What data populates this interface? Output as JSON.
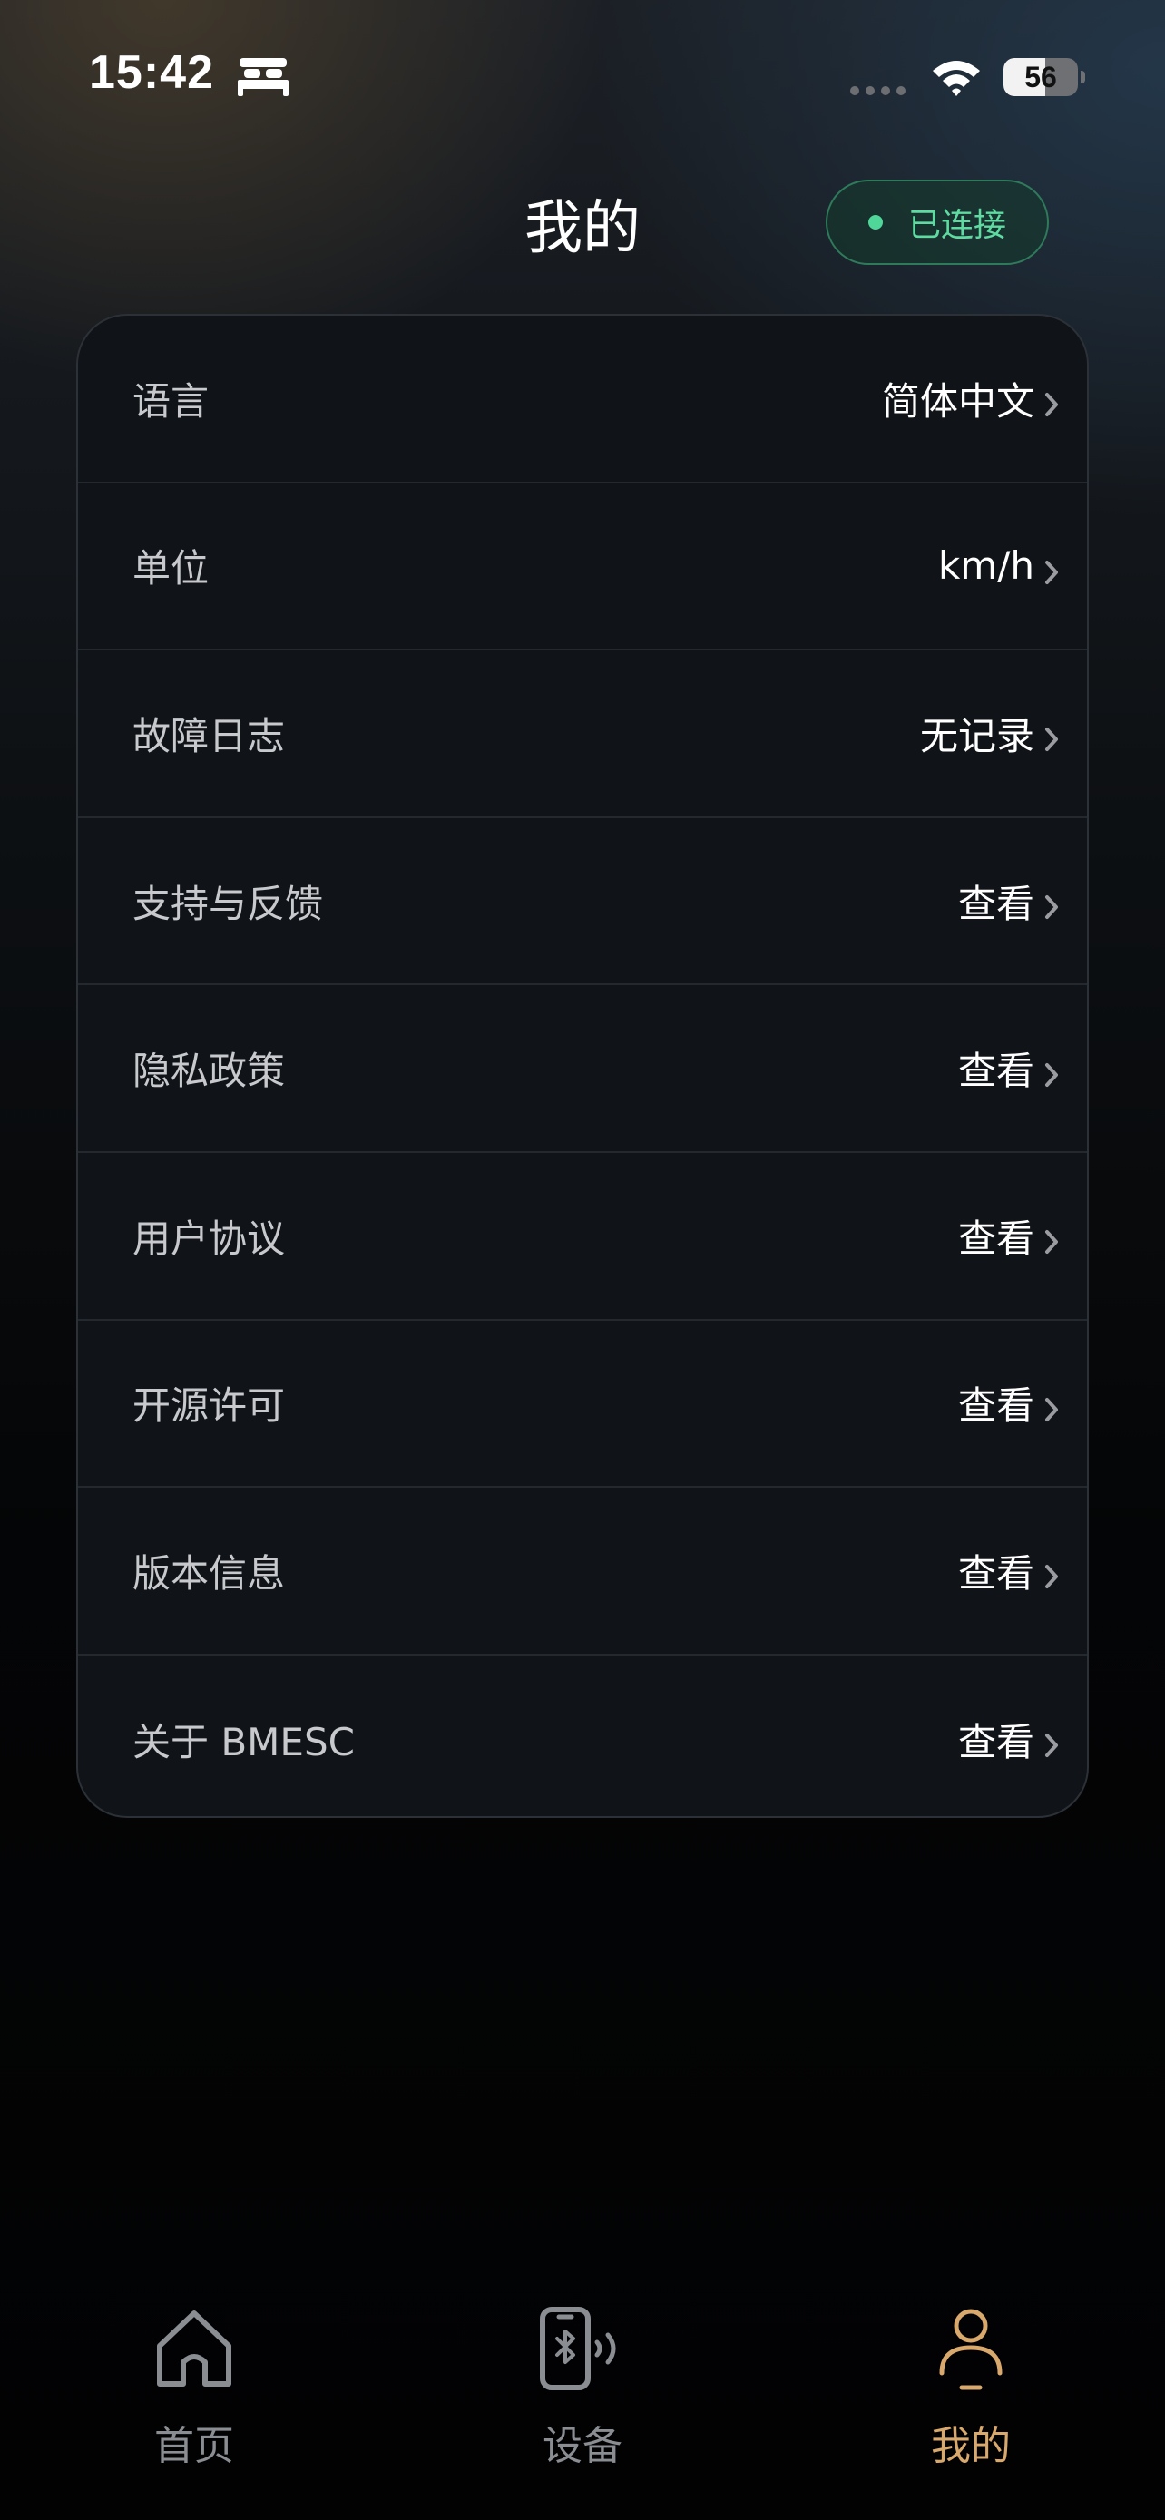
{
  "status_bar": {
    "time": "15:42",
    "battery_level": "56",
    "battery_fraction": 0.56,
    "sleep_focus_icon": "bed-icon",
    "wifi_icon": "wifi-icon"
  },
  "header": {
    "title": "我的",
    "connection_status": "已连接",
    "connection_color": "#4fd79a"
  },
  "settings": [
    {
      "label": "语言",
      "value": "简体中文"
    },
    {
      "label": "单位",
      "value": "km/h"
    },
    {
      "label": "故障日志",
      "value": "无记录"
    },
    {
      "label": "支持与反馈",
      "value": "查看"
    },
    {
      "label": "隐私政策",
      "value": "查看"
    },
    {
      "label": "用户协议",
      "value": "查看"
    },
    {
      "label": "开源许可",
      "value": "查看"
    },
    {
      "label": "版本信息",
      "value": "查看"
    },
    {
      "label": "关于 BMESC",
      "value": "查看"
    }
  ],
  "tab_bar": {
    "tabs": [
      {
        "label": "首页",
        "icon": "home-icon",
        "active": false
      },
      {
        "label": "设备",
        "icon": "bluetooth-phone-icon",
        "active": false
      },
      {
        "label": "我的",
        "icon": "user-icon",
        "active": true
      }
    ],
    "active_color": "#d9a86c",
    "inactive_color": "#8a8d92"
  }
}
